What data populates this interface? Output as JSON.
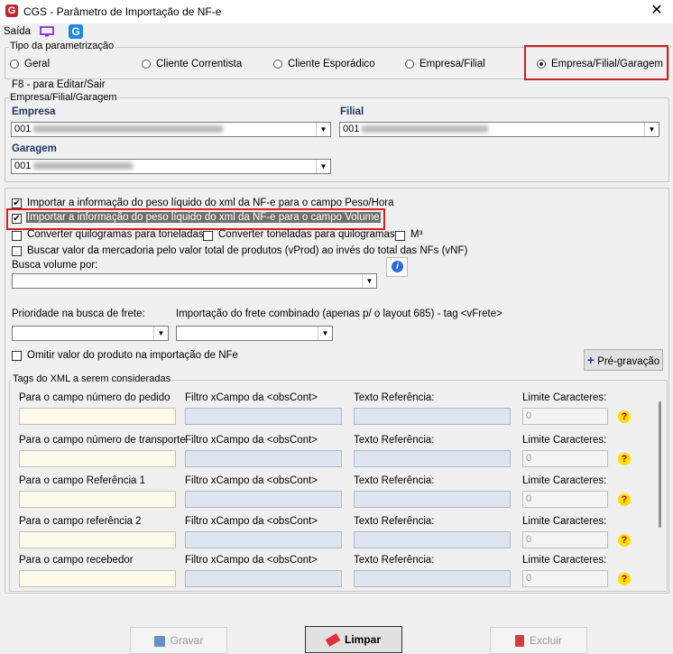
{
  "window": {
    "title": "CGS - Parâmetro de Importação de NF-e"
  },
  "menu": {
    "saida": "Saída"
  },
  "tipo": {
    "legend": "Tipo da parametrização",
    "options": [
      "Geral",
      "Cliente Correntista",
      "Cliente Esporádico",
      "Empresa/Filial",
      "Empresa/Filial/Garagem"
    ],
    "selected": "Empresa/Filial/Garagem"
  },
  "f8_hint": "F8 - para Editar/Sair",
  "efg": {
    "legend": "Empresa/Filial/Garagem",
    "empresa_label": "Empresa",
    "empresa_code": "001",
    "filial_label": "Filial",
    "filial_code": "001",
    "garagem_label": "Garagem",
    "garagem_code": "001"
  },
  "options": {
    "peso_hora": "Importar a informação do peso líquido do xml da NF-e para o campo Peso/Hora",
    "peso_volume": "Importar a informação do peso líquido do xml da NF-e para o campo Volume",
    "kg_ton": "Converter quilogramas para toneladas",
    "ton_kg": "Converter toneladas para quilogramas",
    "m3": "M³",
    "vprod": "Buscar valor da mercadoria pelo valor total de produtos (vProd) ao invés do total das NFs (vNF)",
    "busca_volume": "Busca volume por:",
    "prioridade_frete": "Prioridade na busca de frete:",
    "frete_combinado": "Importação do frete combinado (apenas p/ o layout 685) - tag <vFrete>",
    "omitir": "Omitir valor do produto na importação de NFe",
    "pre_gravacao": "Pré-gravação"
  },
  "tags": {
    "legend": "Tags do XML a serem consideradas",
    "filtro_label": "Filtro xCampo da <obsCont>",
    "texto_label": "Texto Referência:",
    "limite_label": "Limite Caracteres:",
    "rows": [
      {
        "label": "Para o campo número do pedido",
        "limite": "0"
      },
      {
        "label": "Para o campo número de transporte",
        "limite": "0"
      },
      {
        "label": "Para o campo Referência 1",
        "limite": "0"
      },
      {
        "label": "Para o campo referência 2",
        "limite": "0"
      },
      {
        "label": "Para o campo recebedor",
        "limite": "0"
      }
    ]
  },
  "buttons": {
    "gravar": "Gravar",
    "limpar": "Limpar",
    "excluir": "Excluir"
  },
  "colors": {
    "highlight": "#d02020",
    "label_blue": "#1f3864"
  }
}
